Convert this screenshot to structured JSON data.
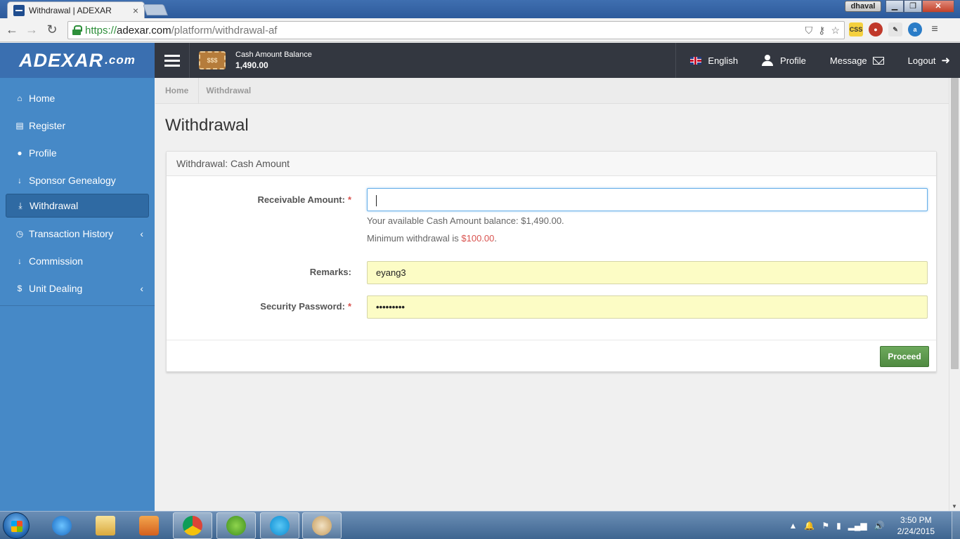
{
  "browser": {
    "tab_title": "Withdrawal | ADEXAR",
    "tab_close": "×",
    "user": "dhaval",
    "url_scheme": "https://",
    "url_host": "adexar.com",
    "url_path": "/platform/withdrawal-af",
    "ext_css_label": "CSS"
  },
  "header": {
    "logo_main": "ADEXAR",
    "logo_suffix": ".com",
    "balance_icon_text": "$$$",
    "balance_label": "Cash Amount Balance",
    "balance_value": "1,490.00",
    "nav": {
      "language": "English",
      "profile": "Profile",
      "message": "Message",
      "logout": "Logout"
    }
  },
  "sidebar": {
    "items": [
      {
        "label": "Home",
        "icon": "home-icon"
      },
      {
        "label": "Register",
        "icon": "register-icon"
      },
      {
        "label": "Profile",
        "icon": "user-icon"
      },
      {
        "label": "Sponsor Genealogy",
        "icon": "arrow-down-icon"
      },
      {
        "label": "Withdrawal",
        "icon": "withdrawal-icon",
        "active": true
      },
      {
        "label": "Transaction History",
        "icon": "history-icon",
        "submenu": true
      },
      {
        "label": "Commission",
        "icon": "arrow-down-icon"
      },
      {
        "label": "Unit Dealing",
        "icon": "dollar-icon",
        "submenu": true
      }
    ]
  },
  "breadcrumb": [
    "Home",
    "Withdrawal"
  ],
  "page_title": "Withdrawal",
  "panel": {
    "heading": "Withdrawal: Cash Amount",
    "receivable_label": "Receivable Amount:",
    "receivable_value": "",
    "available_text": "Your available Cash Amount balance: $1,490.00.",
    "minimum_prefix": "Minimum withdrawal is ",
    "minimum_amount": "$100.00",
    "minimum_suffix": ".",
    "remarks_label": "Remarks:",
    "remarks_value": "eyang3",
    "security_label": "Security Password:",
    "security_value": "•••••••••",
    "required_mark": "*",
    "proceed_label": "Proceed"
  },
  "taskbar": {
    "time": "3:50 PM",
    "date": "2/24/2015"
  },
  "colors": {
    "sidebar": "#4689c7",
    "header": "#333740",
    "accent_red": "#d9534f",
    "proceed_green": "#5b9a4b",
    "autofill": "#fcfcc5"
  }
}
